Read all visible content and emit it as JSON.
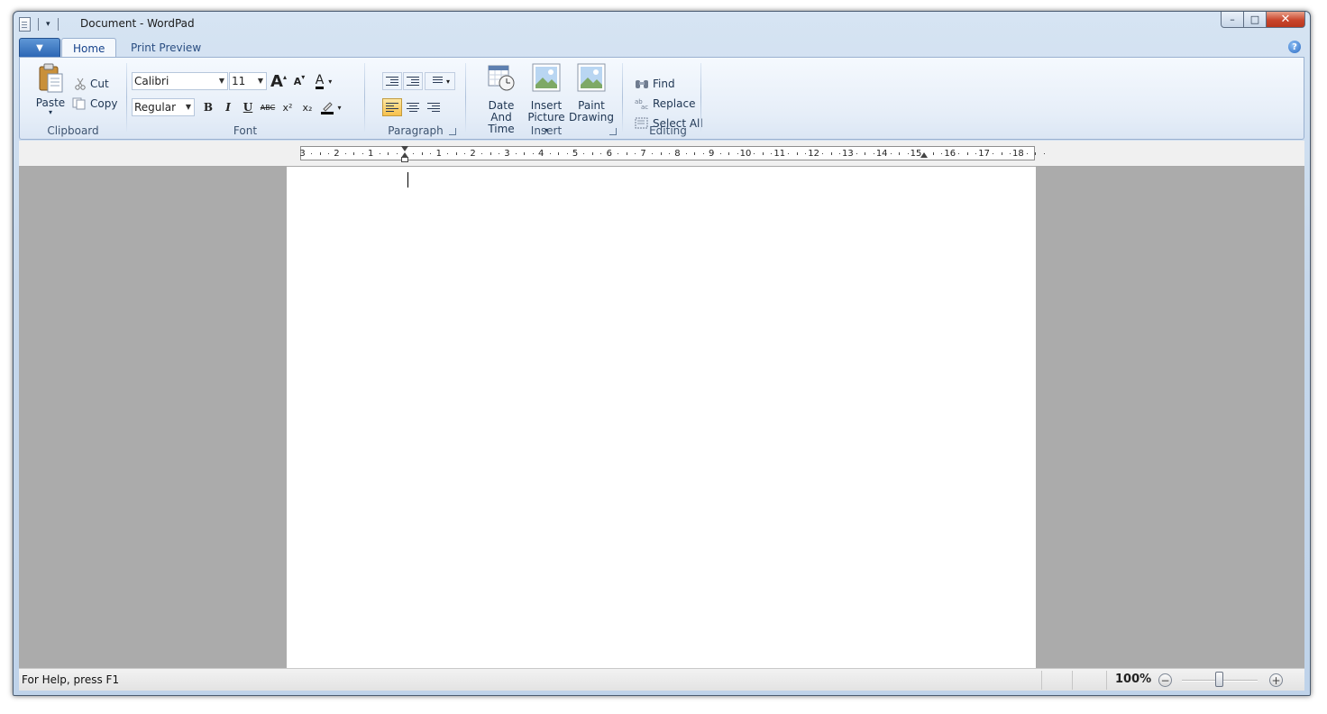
{
  "window": {
    "title": "Document - WordPad",
    "controls": {
      "minimize": "–",
      "maximize": "□",
      "close": "✕"
    }
  },
  "ribbon": {
    "app_button_glyph": "▼",
    "tabs": [
      {
        "label": "Home"
      },
      {
        "label": "Print Preview"
      }
    ],
    "help_glyph": "?",
    "clipboard": {
      "paste": "Paste",
      "cut": "Cut",
      "copy": "Copy",
      "label": "Clipboard"
    },
    "font": {
      "family": "Calibri",
      "size": "11",
      "style": "Regular",
      "bold": "B",
      "italic": "I",
      "underline": "U",
      "strike": "ABC",
      "superscript": "x²",
      "subscript": "x₂",
      "grow": "A",
      "shrink": "A",
      "color_glyph": "A",
      "label": "Font"
    },
    "paragraph": {
      "label": "Paragraph"
    },
    "insert": {
      "date_line1": "Date",
      "date_line2": "And Time",
      "picture_line1": "Insert",
      "picture_line2": "Picture",
      "paint_line1": "Paint",
      "paint_line2": "Drawing",
      "label": "Insert"
    },
    "editing": {
      "find": "Find",
      "replace": "Replace",
      "select_all": "Select All",
      "label": "Editing"
    }
  },
  "ruler": {
    "left_labels": [
      "3",
      "2",
      "1"
    ],
    "right_labels": [
      "1",
      "2",
      "3",
      "4",
      "5",
      "6",
      "7",
      "8",
      "9",
      "10",
      "11",
      "12",
      "13",
      "14",
      "15",
      "16",
      "17",
      "18"
    ]
  },
  "status": {
    "help_text": "For Help, press F1",
    "zoom": "100%",
    "zoom_out": "−",
    "zoom_in": "+",
    "zoom_level_fraction": 0.5
  },
  "colors": {
    "accent": "#2c67b5",
    "tab_text": "#15428b",
    "close_button": "#c9452c",
    "doc_background": "#ababab"
  }
}
